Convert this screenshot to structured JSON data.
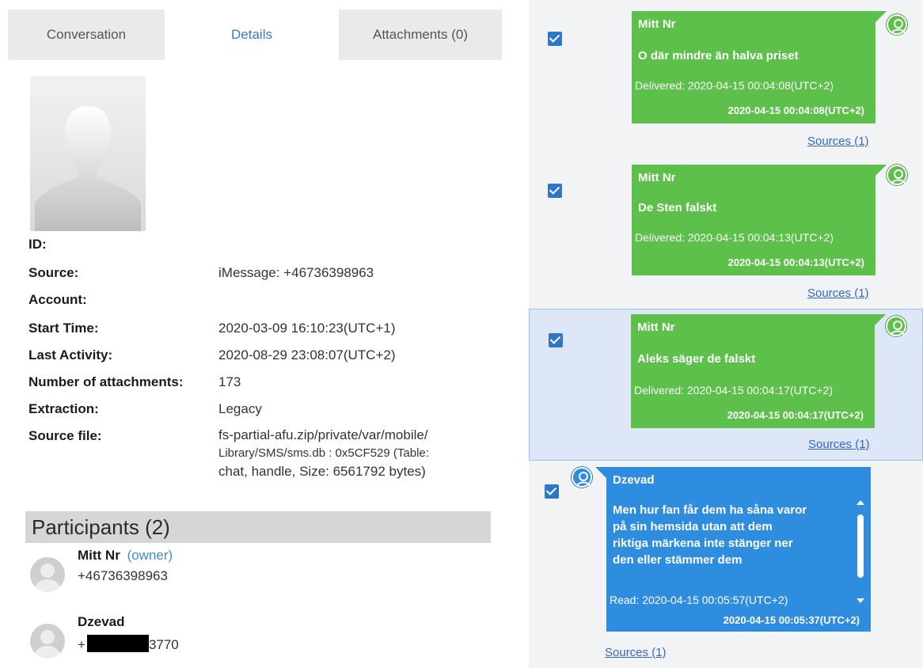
{
  "tabs": [
    {
      "label": "Conversation"
    },
    {
      "label": "Details"
    },
    {
      "label": "Attachments (0)"
    }
  ],
  "details": {
    "rows": [
      {
        "label": "ID:",
        "value": ""
      },
      {
        "label": "Source:",
        "value": "iMessage: +46736398963"
      },
      {
        "label": "Account:",
        "value": ""
      },
      {
        "label": "Start Time:",
        "value": "2020-03-09 16:10:23(UTC+1)"
      },
      {
        "label": "Last Activity:",
        "value": "2020-08-29 23:08:07(UTC+2)"
      },
      {
        "label": "Number of attachments:",
        "value": "173"
      },
      {
        "label": "Extraction:",
        "value": "Legacy"
      },
      {
        "label": "Source file:",
        "value_lines": [
          "fs-partial-afu.zip/private/var/mobile/",
          "Library/SMS/sms.db : 0x5CF529 (Table:",
          "chat, handle, Size: 6561792 bytes)"
        ]
      }
    ]
  },
  "participants": {
    "header": "Participants (2)",
    "items": [
      {
        "name": "Mitt Nr",
        "owner_label": "(owner)",
        "phone": "+46736398963"
      },
      {
        "name": "Dzevad",
        "phone_prefix": "+",
        "phone_suffix": "3770"
      }
    ]
  },
  "messages": [
    {
      "sender": "Mitt Nr",
      "text": "O där mindre än halva priset",
      "status": "Delivered: 2020-04-15 00:04:08(UTC+2)",
      "time": "2020-04-15 00:04:08(UTC+2)",
      "sources": "Sources (1)",
      "color": "#5cc04a"
    },
    {
      "sender": "Mitt Nr",
      "text": "De Sten falskt",
      "status": "Delivered: 2020-04-15 00:04:13(UTC+2)",
      "time": "2020-04-15 00:04:13(UTC+2)",
      "sources": "Sources (1)",
      "color": "#5cc04a"
    },
    {
      "sender": "Mitt Nr",
      "text": "Aleks säger de falskt",
      "status": "Delivered: 2020-04-15 00:04:17(UTC+2)",
      "time": "2020-04-15 00:04:17(UTC+2)",
      "sources": "Sources (1)",
      "color": "#5cc04a",
      "selected": true
    },
    {
      "sender": "Dzevad",
      "text_lines": [
        "Men hur fan får dem ha såna varor",
        "på sin hemsida utan att dem",
        "riktiga märkena inte stänger ner",
        "den eller stämmer dem"
      ],
      "status": "Read: 2020-04-15 00:05:57(UTC+2)",
      "time": "2020-04-15 00:05:37(UTC+2)",
      "sources": "Sources (1)",
      "color": "#2f8de0"
    }
  ],
  "icons": {
    "avatar": "person-silhouette-icon",
    "sender": "user-circle-icon",
    "checkbox": "checkbox-checked-icon"
  }
}
